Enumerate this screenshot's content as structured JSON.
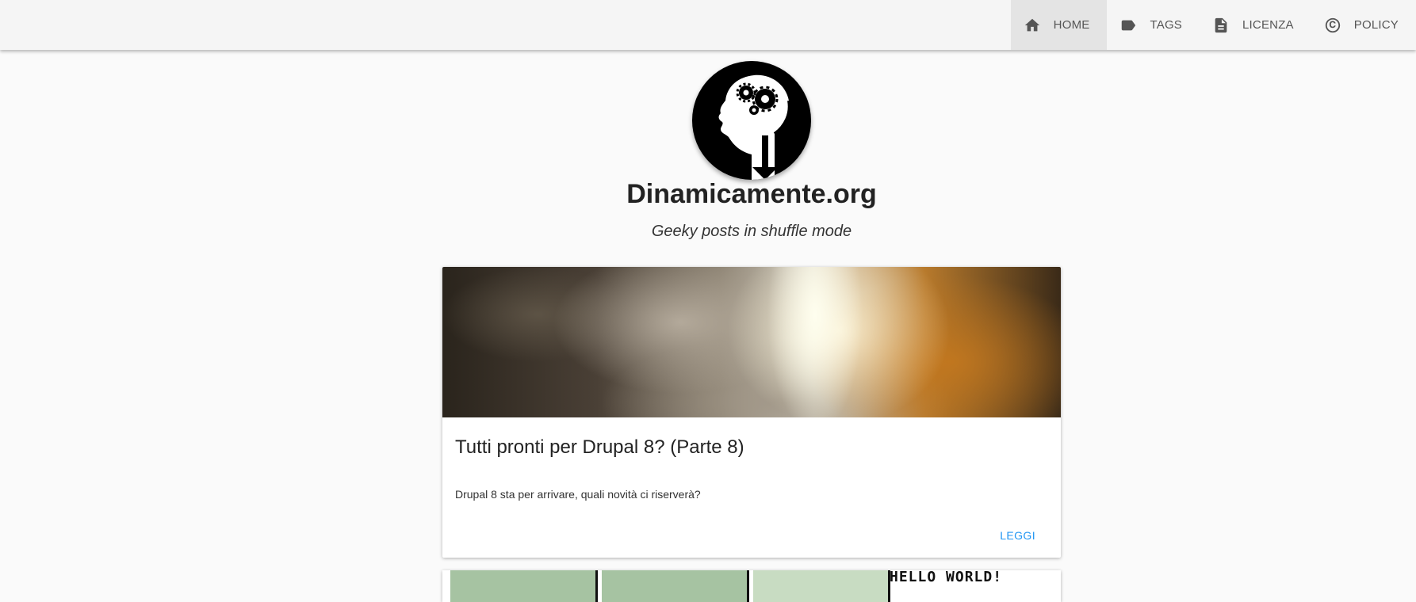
{
  "nav": {
    "items": [
      {
        "label": "HOME",
        "icon": "home-icon",
        "active": true
      },
      {
        "label": "TAGS",
        "icon": "tag-icon",
        "active": false
      },
      {
        "label": "LICENZA",
        "icon": "document-icon",
        "active": false
      },
      {
        "label": "POLICY",
        "icon": "copyright-icon",
        "active": false
      }
    ]
  },
  "site": {
    "title": "Dinamicamente.org",
    "tagline": "Geeky posts in shuffle mode",
    "logo_icon": "brain-gears-logo"
  },
  "posts": [
    {
      "title": "Tutti pronti per Drupal 8? (Parte 8)",
      "description": "Drupal 8 sta per arrivare, quali novità ci riserverà?",
      "action": "LEGGI"
    },
    {
      "image_text": "HELLO WORLD!"
    }
  ],
  "colors": {
    "accent": "#2196f3",
    "topbar": "#f5f5f5",
    "background": "#fafafa"
  }
}
